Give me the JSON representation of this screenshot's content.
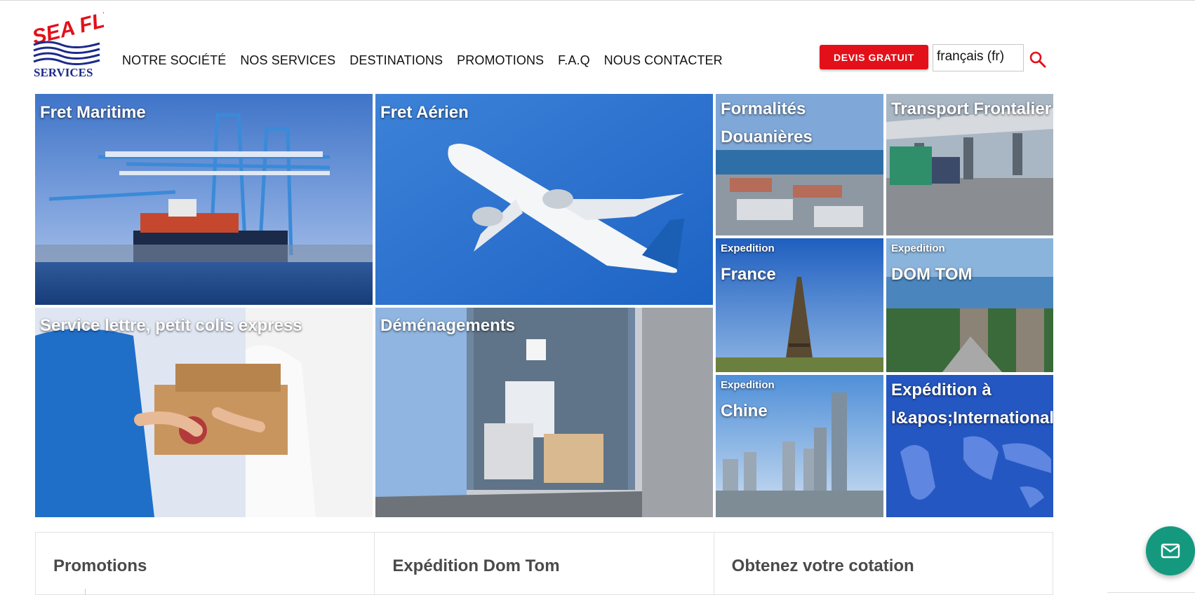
{
  "brand": {
    "logo_top": "SEA FLY",
    "logo_bottom": "SERVICES",
    "colors": {
      "red": "#e3101a",
      "navy": "#1c2a8a",
      "green": "#14997f"
    }
  },
  "nav": {
    "items": [
      {
        "label": "NOTRE SOCIÉTÉ"
      },
      {
        "label": "NOS SERVICES"
      },
      {
        "label": "DESTINATIONS"
      },
      {
        "label": "PROMOTIONS"
      },
      {
        "label": "F.A.Q"
      },
      {
        "label": "NOUS CONTACTER"
      }
    ]
  },
  "header": {
    "devis_label": "DEVIS GRATUIT",
    "language_value": "français (fr)",
    "search_icon": "search-icon"
  },
  "tiles": {
    "fret_maritime": {
      "title": "Fret Maritime",
      "icon": "port-cranes-image"
    },
    "fret_aerien": {
      "title": "Fret Aérien",
      "icon": "airplane-image"
    },
    "formalites": {
      "title_line1": "Formalités",
      "title_line2": "Douanières"
    },
    "transport_frontalier": {
      "title": "Transport Frontalier"
    },
    "service_lettre": {
      "title": "Service lettre, petit colis express"
    },
    "demenagements": {
      "title": "Déménagements"
    },
    "france": {
      "kicker": "Expedition",
      "title": "France"
    },
    "domtom": {
      "kicker": "Expedition",
      "title": "DOM TOM"
    },
    "chine": {
      "kicker": "Expedition",
      "title": "Chine"
    },
    "international": {
      "title_line1": "Expédition à",
      "title_line2": "l&apos;International"
    }
  },
  "cards": [
    {
      "title": "Promotions"
    },
    {
      "title": "Expédition Dom Tom"
    },
    {
      "title": "Obtenez votre cotation"
    }
  ],
  "chat": {
    "icon": "mail-icon"
  }
}
